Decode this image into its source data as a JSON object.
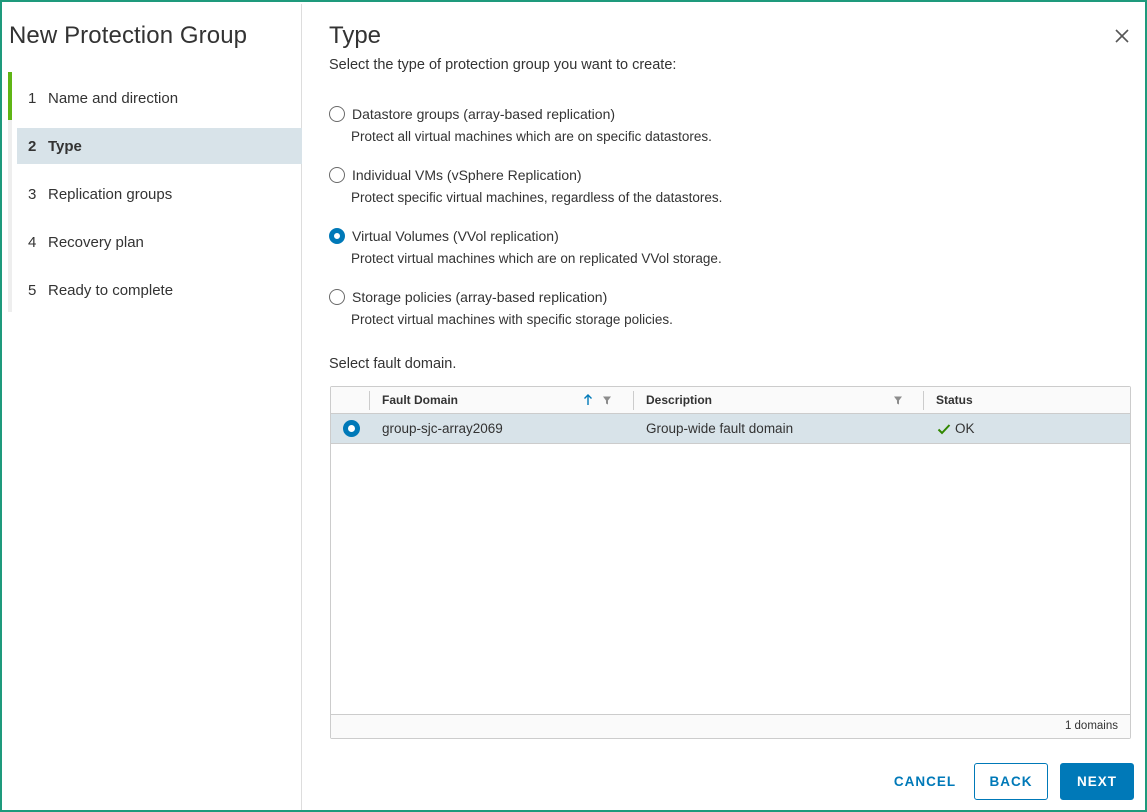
{
  "wizard": {
    "title": "New Protection Group",
    "steps": [
      {
        "num": "1",
        "label": "Name and direction"
      },
      {
        "num": "2",
        "label": "Type"
      },
      {
        "num": "3",
        "label": "Replication groups"
      },
      {
        "num": "4",
        "label": "Recovery plan"
      },
      {
        "num": "5",
        "label": "Ready to complete"
      }
    ]
  },
  "page": {
    "title": "Type",
    "subtitle": "Select the type of protection group you want to create:",
    "options": [
      {
        "label": "Datastore groups (array-based replication)",
        "desc": "Protect all virtual machines which are on specific datastores.",
        "selected": false
      },
      {
        "label": "Individual VMs (vSphere Replication)",
        "desc": "Protect specific virtual machines, regardless of the datastores.",
        "selected": false
      },
      {
        "label": "Virtual Volumes (VVol replication)",
        "desc": "Protect virtual machines which are on replicated VVol storage.",
        "selected": true
      },
      {
        "label": "Storage policies (array-based replication)",
        "desc": "Protect virtual machines with specific storage policies.",
        "selected": false
      }
    ],
    "fault_label": "Select fault domain."
  },
  "grid": {
    "columns": [
      "Fault Domain",
      "Description",
      "Status"
    ],
    "rows": [
      {
        "fault_domain": "group-sjc-array2069",
        "description": "Group-wide fault domain",
        "status": "OK"
      }
    ],
    "footer": "1 domains"
  },
  "buttons": {
    "cancel": "CANCEL",
    "back": "BACK",
    "next": "NEXT"
  },
  "colors": {
    "accent": "#0079b8",
    "progress": "#60b515",
    "selected_row": "#d8e3e9",
    "frame": "#1e9a7c"
  },
  "icons": {
    "close": "close-icon",
    "sort": "arrow-up-icon",
    "filter": "filter-icon",
    "ok": "check-icon"
  }
}
